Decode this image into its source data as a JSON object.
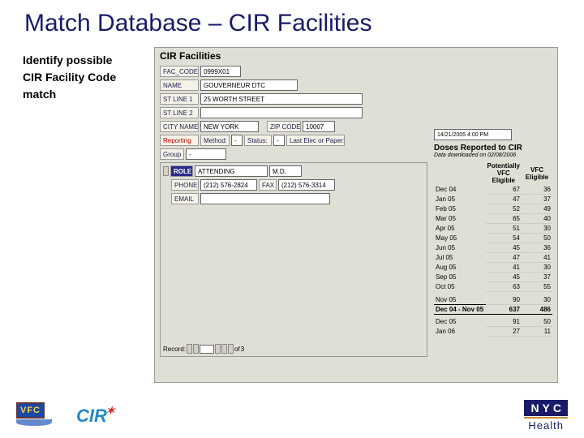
{
  "slide": {
    "title": "Match Database – CIR Facilities",
    "sidebar_l1": "Identify possible",
    "sidebar_l2": "CIR Facility Code",
    "sidebar_l3": "match"
  },
  "form": {
    "title": "CIR Facilities",
    "fac_code_lbl": "FAC_CODE",
    "fac_code_val": "0999X01",
    "name_lbl": "NAME",
    "name_val": "GOUVERNEUR DTC",
    "st1_lbl": "ST LINE 1",
    "st1_val": "25 WORTH STREET",
    "st2_lbl": "ST LINE 2",
    "st2_val": "",
    "city_lbl": "CITY NAME",
    "city_val": "NEW YORK",
    "zip_lbl": "ZIP CODE",
    "zip_val": "10007",
    "reporting_lbl": "Reporting",
    "method_lbl": "Method:",
    "method_val": "-",
    "status_lbl": "Status:",
    "status_val": "-",
    "last_lbl": "Last Elec or Paper:",
    "last_val": "14/21/2005 4:00 PM",
    "group_lbl": "Group",
    "group_val": "-",
    "role_lbl": "ROLE",
    "role_val": "ATTENDING",
    "md_val": "M.D.",
    "phone_lbl": "PHONE",
    "phone_val": "(212) 576-2824",
    "fax_lbl": "FAX",
    "fax_val": "(212) 576-3314",
    "email_lbl": "EMAIL",
    "email_val": "",
    "record_lbl": "Record:",
    "record_of": "of",
    "record_total": "3"
  },
  "doses": {
    "title": "Doses Reported to CIR",
    "subtitle": "Data downloaded on 02/08/2006",
    "h1": "Potentially VFC Eligible",
    "h2": "VFC Eligible",
    "rows": [
      {
        "m": "Dec 04",
        "a": "67",
        "b": "36"
      },
      {
        "m": "Jan 05",
        "a": "47",
        "b": "37"
      },
      {
        "m": "Feb 05",
        "a": "52",
        "b": "49"
      },
      {
        "m": "Mar 05",
        "a": "65",
        "b": "40"
      },
      {
        "m": "Apr 05",
        "a": "51",
        "b": "30"
      },
      {
        "m": "May 05",
        "a": "54",
        "b": "50"
      },
      {
        "m": "Jun 05",
        "a": "45",
        "b": "36"
      },
      {
        "m": "Jul 05",
        "a": "47",
        "b": "41"
      },
      {
        "m": "Aug 05",
        "a": "41",
        "b": "30"
      },
      {
        "m": "Sep 05",
        "a": "45",
        "b": "37"
      },
      {
        "m": "Oct 05",
        "a": "63",
        "b": "55"
      }
    ],
    "total_m": "Dec 04 - Nov 05",
    "total_a": "637",
    "total_b": "486",
    "extra": [
      {
        "m": "Dec 05",
        "a": "91",
        "b": "50"
      },
      {
        "m": "Jan 06",
        "a": "27",
        "b": "11"
      }
    ],
    "nov_m": "Nov 05",
    "nov_a": "90",
    "nov_b": "30"
  },
  "footer": {
    "vfc": "VFC",
    "cir": "CIR",
    "nyc": "NYC",
    "health": "Health"
  }
}
